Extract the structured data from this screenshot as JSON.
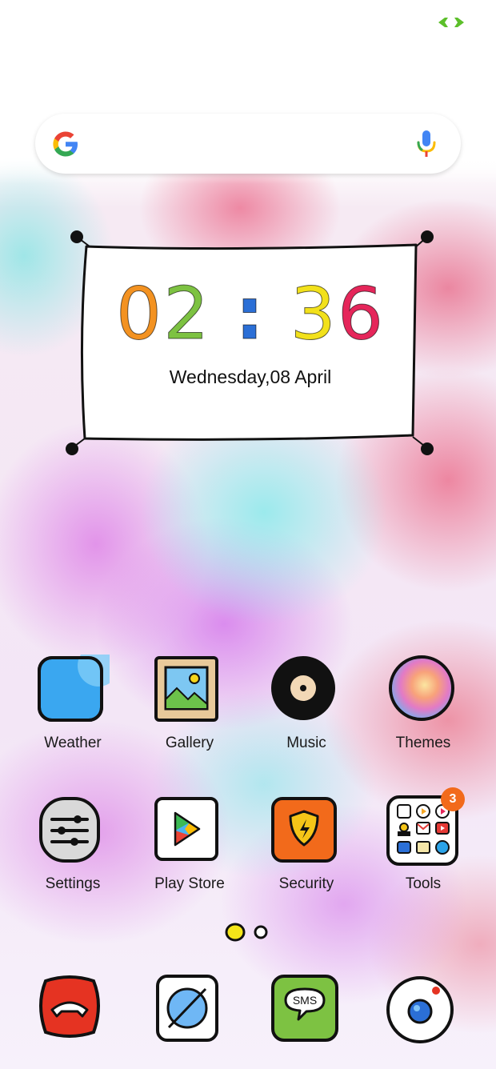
{
  "search": {
    "logo": "google-g-icon",
    "voice": "microphone-icon"
  },
  "clock": {
    "hour1": "0",
    "hour2": "2",
    "separator": ":",
    "minute1": "3",
    "minute2": "6",
    "date": "Wednesday,08 April",
    "digit_colors": [
      "#f39221",
      "#7dc242",
      "#f2e11b",
      "#e5265a"
    ]
  },
  "apps_row1": [
    {
      "label": "Weather",
      "icon": "weather-icon"
    },
    {
      "label": "Gallery",
      "icon": "gallery-icon"
    },
    {
      "label": "Music",
      "icon": "music-icon"
    },
    {
      "label": "Themes",
      "icon": "themes-icon"
    }
  ],
  "apps_row2": [
    {
      "label": "Settings",
      "icon": "settings-icon"
    },
    {
      "label": "Play Store",
      "icon": "play-store-icon"
    },
    {
      "label": "Security",
      "icon": "security-icon"
    },
    {
      "label": "Tools",
      "icon": "tools-folder-icon",
      "badge": "3"
    }
  ],
  "pages": {
    "count": 2,
    "active": 0
  },
  "dock": [
    {
      "icon": "phone-icon"
    },
    {
      "icon": "browser-icon"
    },
    {
      "icon": "sms-icon",
      "text": "SMS"
    },
    {
      "icon": "camera-icon"
    }
  ],
  "colors": {
    "accent_yellow": "#f5e619",
    "badge": "#f26a1b",
    "status_green": "#5cbf2a"
  }
}
